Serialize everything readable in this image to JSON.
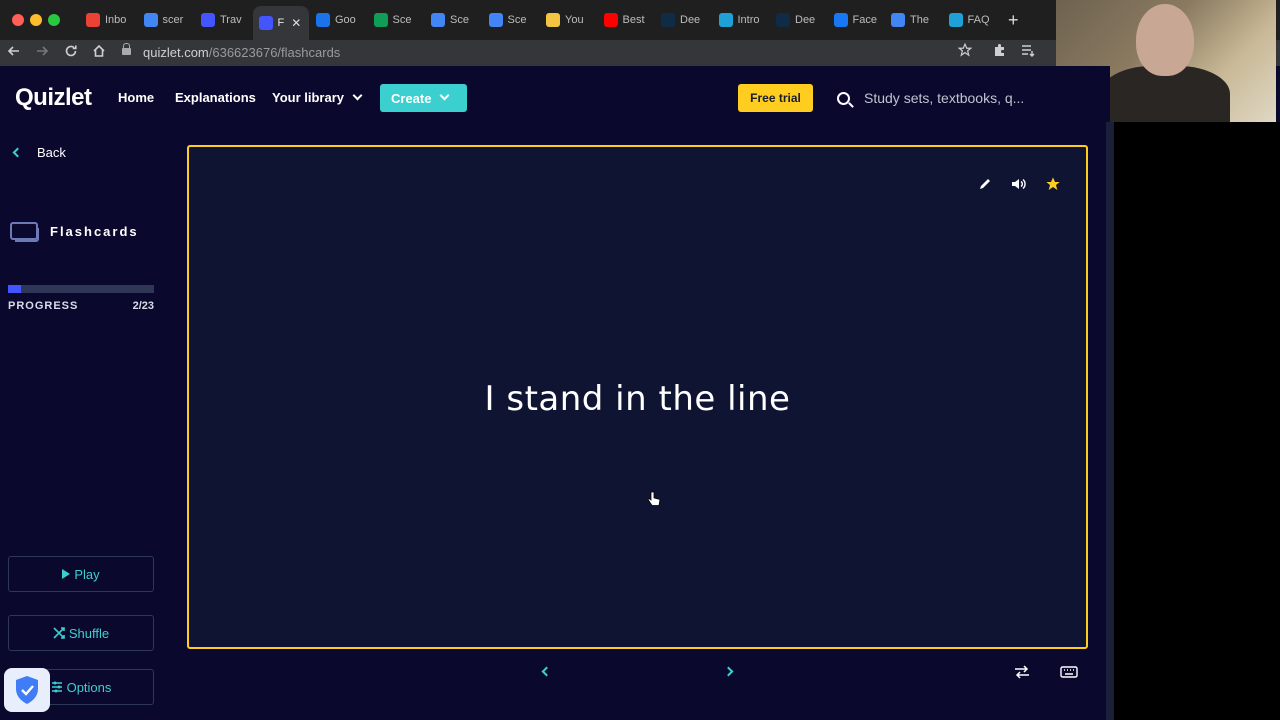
{
  "browser": {
    "tabs": [
      {
        "label": "Inbo",
        "icon": "gmail-icon",
        "color": "#ea4335"
      },
      {
        "label": "scer",
        "icon": "docs-icon",
        "color": "#4285f4"
      },
      {
        "label": "Trav",
        "icon": "quizlet-icon",
        "color": "#4255ff"
      },
      {
        "label": "F",
        "icon": "quizlet-icon",
        "color": "#4255ff",
        "active": true
      },
      {
        "label": "Goo",
        "icon": "slides-icon",
        "color": "#1a73e8"
      },
      {
        "label": "Sce",
        "icon": "sheets-icon",
        "color": "#0f9d58"
      },
      {
        "label": "Sce",
        "icon": "docs-icon",
        "color": "#4285f4"
      },
      {
        "label": "Sce",
        "icon": "docs-icon",
        "color": "#4285f4"
      },
      {
        "label": "You",
        "icon": "doc-yellow-icon",
        "color": "#f4c542"
      },
      {
        "label": "Best",
        "icon": "youtube-icon",
        "color": "#ff0000"
      },
      {
        "label": "Dee",
        "icon": "deepl-icon",
        "color": "#0f2b46"
      },
      {
        "label": "Intro",
        "icon": "app-icon",
        "color": "#1fa0d6"
      },
      {
        "label": "Dee",
        "icon": "deepl-icon",
        "color": "#0f2b46"
      },
      {
        "label": "Face",
        "icon": "facebook-icon",
        "color": "#1877f2"
      },
      {
        "label": "The",
        "icon": "google-icon",
        "color": "#4285f4"
      },
      {
        "label": "FAQ",
        "icon": "app-icon",
        "color": "#1fa0d6"
      }
    ],
    "url_host": "quizlet.com",
    "url_path": "/636623676/flashcards"
  },
  "header": {
    "logo": "Quizlet",
    "nav": {
      "home": "Home",
      "explanations": "Explanations",
      "library": "Your library"
    },
    "create": "Create",
    "free_trial": "Free trial",
    "search_placeholder": "Study sets, textbooks, q..."
  },
  "sidebar": {
    "back": "Back",
    "mode": "Flashcards",
    "progress_label": "PROGRESS",
    "progress_count": "2/23",
    "progress_fraction": 0.087,
    "play": "Play",
    "shuffle": "Shuffle",
    "options": "Options"
  },
  "card": {
    "text": "I stand in the line"
  },
  "colors": {
    "bg": "#0a092d",
    "accent": "#3ccfcf",
    "highlight": "#ffcd1f",
    "progress": "#4255ff"
  }
}
